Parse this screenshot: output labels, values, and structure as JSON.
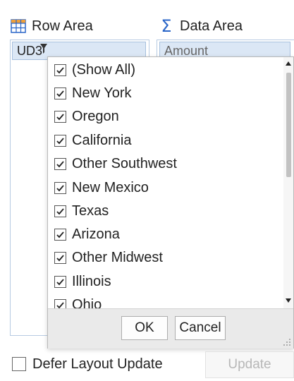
{
  "row_area": {
    "title": "Row Area",
    "field": "UD3"
  },
  "data_area": {
    "title": "Data Area",
    "field": "Amount"
  },
  "filter_list": {
    "items": [
      {
        "label": "(Show All)",
        "checked": true
      },
      {
        "label": "New York",
        "checked": true
      },
      {
        "label": "Oregon",
        "checked": true
      },
      {
        "label": "California",
        "checked": true
      },
      {
        "label": "Other Southwest",
        "checked": true
      },
      {
        "label": "New Mexico",
        "checked": true
      },
      {
        "label": "Texas",
        "checked": true
      },
      {
        "label": "Arizona",
        "checked": true
      },
      {
        "label": "Other Midwest",
        "checked": true
      },
      {
        "label": "Illinois",
        "checked": true
      },
      {
        "label": "Ohio",
        "checked": true
      }
    ],
    "ok_label": "OK",
    "cancel_label": "Cancel"
  },
  "footer": {
    "defer_label": "Defer Layout Update",
    "update_label": "Update",
    "defer_checked": false
  },
  "icons": {
    "row_area": "table-grid-icon",
    "data_area": "sigma-icon",
    "filter": "funnel-filter-icon"
  },
  "colors": {
    "accent_blue": "#2a66c8",
    "pill_fill": "#dbe7f5",
    "pill_border": "#a7c0de",
    "area_border": "#b7cbe2"
  }
}
